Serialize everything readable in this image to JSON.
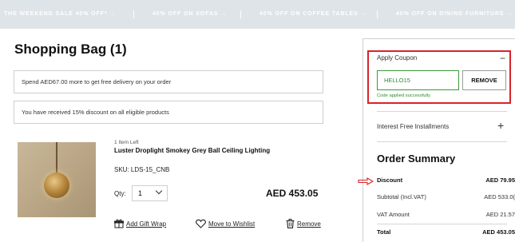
{
  "promo_bar": {
    "items": [
      "THE WEEKEND SALE 40% OFF* →",
      "40% OFF ON SOFAS →",
      "40% OFF ON COFFEE TABLES →",
      "40% OFF ON DINING FURNITURE →"
    ],
    "separator": "|"
  },
  "bag": {
    "title": "Shopping Bag (1)",
    "notices": [
      "Spend AED67.00 more to get free delivery on your order",
      "You have received 15% discount on all eligible products"
    ]
  },
  "product": {
    "stock": "1 Item Left",
    "name": "Luster Droplight Smokey Grey Ball Ceiling Lighting",
    "sku": "SKU: LDS-15_CNB",
    "qty_label": "Qty:",
    "qty_value": "1",
    "price": "AED 453.05",
    "actions": {
      "gift": "Add Gift Wrap",
      "wishlist": "Move to Wishlist",
      "remove": "Remove"
    },
    "icons": [
      "gift-icon",
      "heart-icon",
      "trash-icon",
      "chevron-down-icon"
    ]
  },
  "coupon": {
    "title": "Apply Coupon",
    "toggle": "−",
    "code": "HELLO15",
    "button": "REMOVE",
    "status": "Code applied successfully",
    "highlight_color": "#d8232a",
    "success_color": "#2e8b2e"
  },
  "installments": {
    "label": "Interest Free Installments",
    "toggle": "+"
  },
  "summary": {
    "title": "Order Summary",
    "rows": [
      {
        "label": "Discount",
        "value": "AED 79.95"
      },
      {
        "label": "Subtotal (Incl.VAT)",
        "value": "AED 533.0("
      },
      {
        "label": "VAT Amount",
        "value": "AED 21.57"
      },
      {
        "label": "Total",
        "value": "AED 453.05"
      }
    ]
  }
}
